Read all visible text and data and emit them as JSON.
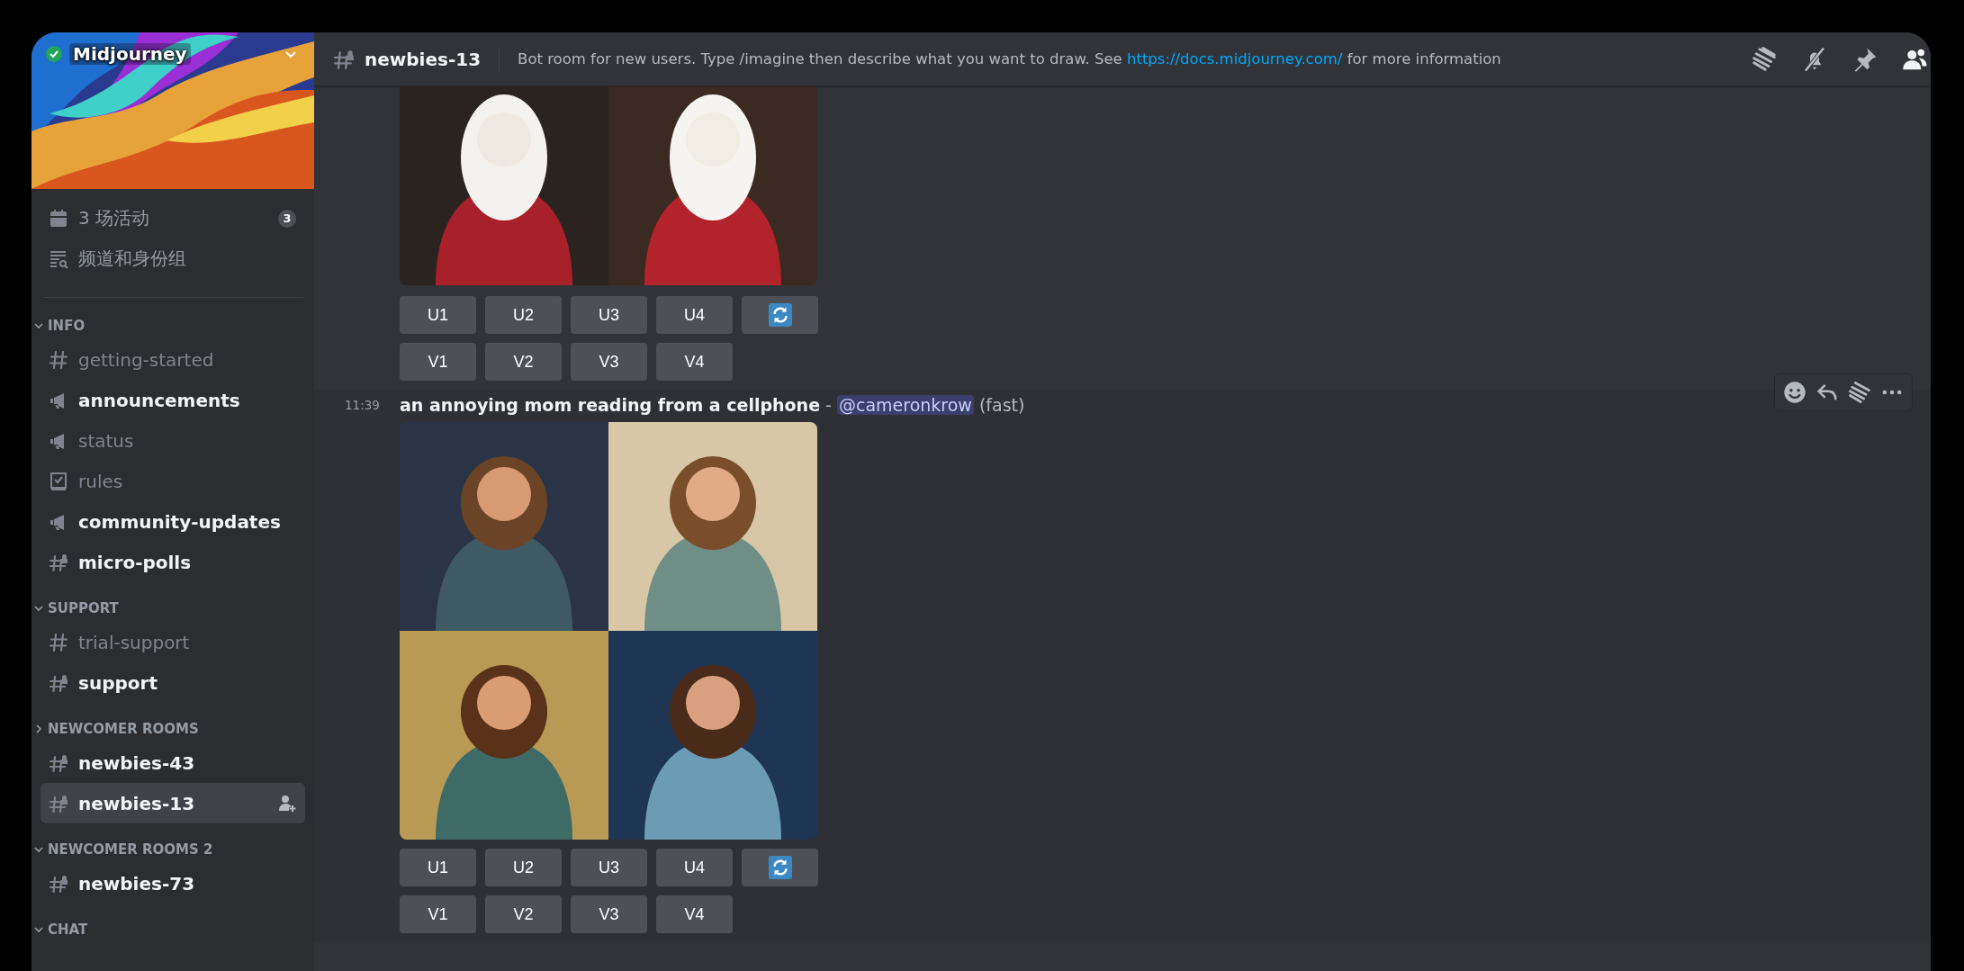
{
  "server": {
    "name": "Midjourney",
    "verified": true
  },
  "sidebar": {
    "shortcuts": [
      {
        "kind": "events",
        "label": "3 场活动",
        "badge": "3"
      },
      {
        "kind": "browse",
        "label": "频道和身份组"
      }
    ],
    "categories": [
      {
        "name": "INFO",
        "expanded": true,
        "channels": [
          {
            "name": "getting-started",
            "kind": "text",
            "unread": false,
            "selected": false
          },
          {
            "name": "announcements",
            "kind": "announcement",
            "unread": true,
            "selected": false
          },
          {
            "name": "status",
            "kind": "announcement",
            "unread": false,
            "selected": false
          },
          {
            "name": "rules",
            "kind": "rules",
            "unread": false,
            "selected": false
          },
          {
            "name": "community-updates",
            "kind": "announcement",
            "unread": true,
            "selected": false
          },
          {
            "name": "micro-polls",
            "kind": "locked",
            "unread": true,
            "selected": false
          }
        ]
      },
      {
        "name": "SUPPORT",
        "expanded": true,
        "channels": [
          {
            "name": "trial-support",
            "kind": "text",
            "unread": false,
            "selected": false
          },
          {
            "name": "support",
            "kind": "locked",
            "unread": true,
            "selected": false
          }
        ]
      },
      {
        "name": "NEWCOMER ROOMS",
        "expanded": false,
        "channels": [
          {
            "name": "newbies-43",
            "kind": "locked",
            "unread": true,
            "selected": false
          },
          {
            "name": "newbies-13",
            "kind": "locked",
            "unread": true,
            "selected": true
          }
        ]
      },
      {
        "name": "NEWCOMER ROOMS 2",
        "expanded": true,
        "channels": [
          {
            "name": "newbies-73",
            "kind": "locked",
            "unread": true,
            "selected": false
          }
        ]
      },
      {
        "name": "CHAT",
        "expanded": true
      }
    ]
  },
  "header": {
    "channel": "newbies-13",
    "kind": "locked",
    "topic": "Bot room for new users. Type /imagine then describe what you want to draw. See ",
    "topic_link": "https://docs.midjourney.com/",
    "topic_after": " for more information"
  },
  "messages": [
    {
      "hovered": false,
      "buttons": [
        [
          {
            "kind": "text",
            "label": "U1"
          },
          {
            "kind": "text",
            "label": "U2"
          },
          {
            "kind": "text",
            "label": "U3"
          },
          {
            "kind": "text",
            "label": "U4"
          },
          {
            "kind": "reroll"
          }
        ],
        [
          {
            "kind": "text",
            "label": "V1"
          },
          {
            "kind": "text",
            "label": "V2"
          },
          {
            "kind": "text",
            "label": "V3"
          },
          {
            "kind": "text",
            "label": "V4"
          }
        ]
      ]
    },
    {
      "hovered": true,
      "time": "11:39",
      "content": "**an annoying mom reading from a cellphone** - ",
      "mention": "@cameronkrow",
      "suffix": " (fast)",
      "buttons": [
        [
          {
            "kind": "text",
            "label": "U1"
          },
          {
            "kind": "text",
            "label": "U2"
          },
          {
            "kind": "text",
            "label": "U3"
          },
          {
            "kind": "text",
            "label": "U4"
          },
          {
            "kind": "reroll"
          }
        ],
        [
          {
            "kind": "text",
            "label": "V1"
          },
          {
            "kind": "text",
            "label": "V2"
          },
          {
            "kind": "text",
            "label": "V3"
          },
          {
            "kind": "text",
            "label": "V4"
          }
        ]
      ]
    }
  ]
}
